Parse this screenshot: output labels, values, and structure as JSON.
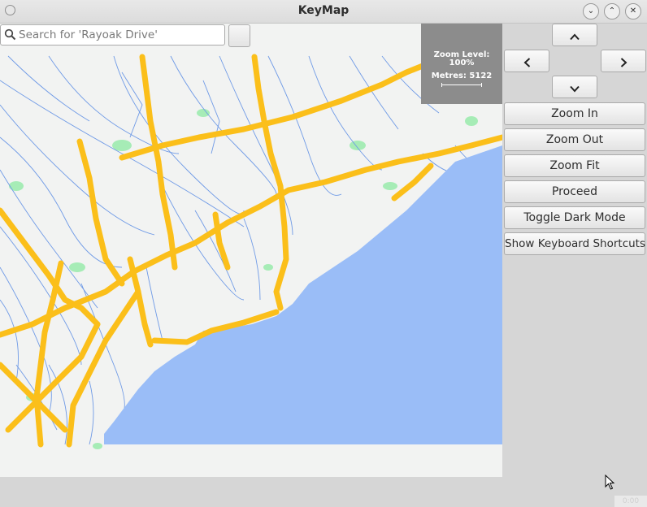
{
  "window": {
    "title": "KeyMap"
  },
  "search": {
    "placeholder": "Search for 'Rayoak Drive'"
  },
  "zoom": {
    "label": "Zoom Level:",
    "value": "100%",
    "metres": "Metres: 5122"
  },
  "nav": {
    "up_icon": "chevron-up-icon",
    "down_icon": "chevron-down-icon",
    "left_icon": "chevron-left-icon",
    "right_icon": "chevron-right-icon"
  },
  "buttons": {
    "zoom_in": "Zoom In",
    "zoom_out": "Zoom Out",
    "zoom_fit": "Zoom Fit",
    "proceed": "Proceed",
    "toggle_dark": "Toggle Dark Mode",
    "shortcuts": "Show Keyboard Shortcuts"
  },
  "status": {
    "counter": "0:00"
  },
  "colors": {
    "water": "#9abdf7",
    "land": "#f2f3f2",
    "highway": "#fbbf1a",
    "river": "#6f9ae6",
    "park": "#a6ecb6",
    "info_box": "#8c8c8c"
  }
}
